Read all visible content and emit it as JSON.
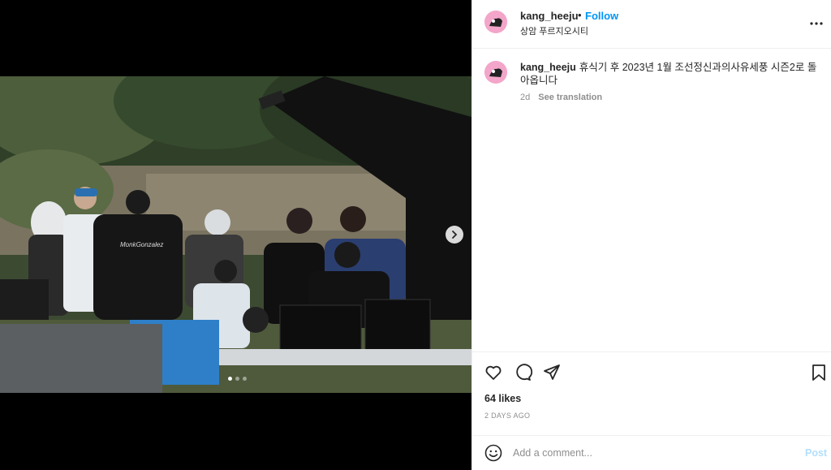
{
  "post": {
    "username": "kang_heeju",
    "separator": "•",
    "follow_label": "Follow",
    "location": "상암 푸르지오시티",
    "more_icon": "ellipsis-icon",
    "caption_text": "휴식기 후 2023년 1월 조선정신과의사유세풍 시즌2로 돌아옵니다",
    "time_short": "2d",
    "see_translation": "See translation",
    "likes": "64 likes",
    "time_ago": "2 DAYS AGO",
    "comment_placeholder": "Add a comment...",
    "post_label": "Post"
  },
  "media": {
    "photo_alt": "Film crew gathered around monitors on an outdoor set",
    "shirt_text": "MonkGonzalez",
    "carousel_count": 3,
    "carousel_active": 1
  },
  "icons": {
    "heart": "heart-icon",
    "comment": "comment-icon",
    "share": "paper-plane-icon",
    "save": "bookmark-icon",
    "emoji": "smiley-icon",
    "next": "chevron-right-icon"
  },
  "colors": {
    "accent": "#0095f6",
    "post_disabled": "#b2dffc",
    "avatar_bg": "#f3a6c9"
  }
}
